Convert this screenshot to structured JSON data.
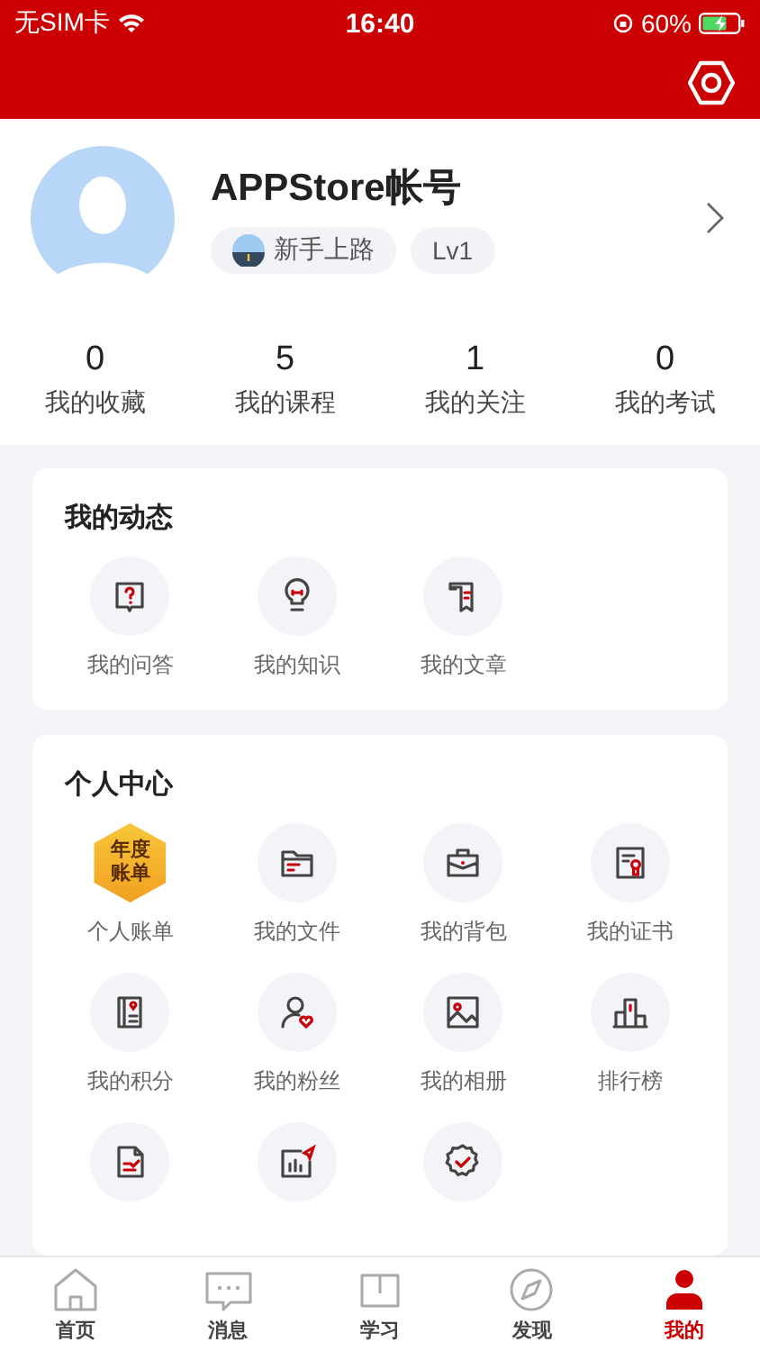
{
  "status_bar": {
    "carrier": "无SIM卡",
    "time": "16:40",
    "battery": "60%"
  },
  "profile": {
    "name": "APPStore帐号",
    "tags": [
      {
        "kind": "road",
        "label": "新手上路"
      },
      {
        "kind": "plain",
        "label": "Lv1"
      }
    ]
  },
  "stats": [
    {
      "value": "0",
      "label": "我的收藏"
    },
    {
      "value": "5",
      "label": "我的课程"
    },
    {
      "value": "1",
      "label": "我的关注"
    },
    {
      "value": "0",
      "label": "我的考试"
    }
  ],
  "dynamics": {
    "title": "我的动态",
    "items": [
      {
        "label": "我的问答"
      },
      {
        "label": "我的知识"
      },
      {
        "label": "我的文章"
      }
    ]
  },
  "personal_center": {
    "title": "个人中心",
    "items": [
      {
        "kind": "badge",
        "badge": "年度账单",
        "label": "个人账单"
      },
      {
        "kind": "icon",
        "label": "我的文件"
      },
      {
        "kind": "icon",
        "label": "我的背包"
      },
      {
        "kind": "icon",
        "label": "我的证书"
      },
      {
        "kind": "icon",
        "label": "我的积分"
      },
      {
        "kind": "icon",
        "label": "我的粉丝"
      },
      {
        "kind": "icon",
        "label": "我的相册"
      },
      {
        "kind": "icon",
        "label": "排行榜"
      },
      {
        "kind": "icon"
      },
      {
        "kind": "icon"
      },
      {
        "kind": "icon"
      }
    ]
  },
  "tab_bar": [
    {
      "label": "首页",
      "selected": false
    },
    {
      "label": "消息",
      "selected": false
    },
    {
      "label": "学习",
      "selected": false
    },
    {
      "label": "发现",
      "selected": false
    },
    {
      "label": "我的",
      "selected": true
    }
  ]
}
